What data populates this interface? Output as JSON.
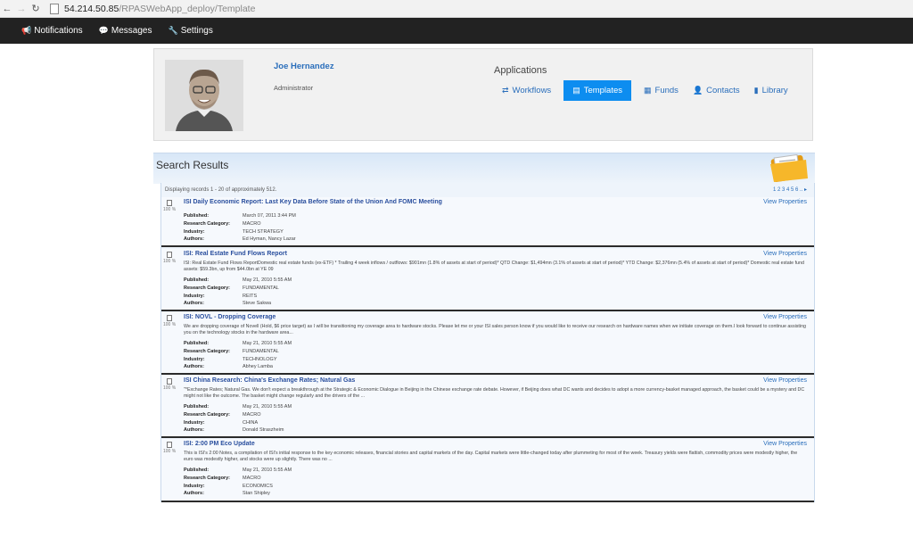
{
  "browser": {
    "url_host": "54.214.50.85",
    "url_path": "/RPASWebApp_deploy/Template"
  },
  "nav": {
    "items": [
      {
        "icon": "bullhorn-icon",
        "glyph": "📢",
        "label": "Notifications"
      },
      {
        "icon": "comment-icon",
        "glyph": "💬",
        "label": "Messages"
      },
      {
        "icon": "wrench-icon",
        "glyph": "🔧",
        "label": "Settings"
      }
    ]
  },
  "profile": {
    "name": "Joe Hernandez",
    "role": "Administrator"
  },
  "applications": {
    "title": "Applications",
    "items": [
      {
        "icon": "swap-icon",
        "glyph": "⇄",
        "label": "Workflows",
        "active": false
      },
      {
        "icon": "document-icon",
        "glyph": "▤",
        "label": "Templates",
        "active": true
      },
      {
        "icon": "bank-icon",
        "glyph": "▦",
        "label": "Funds",
        "active": false
      },
      {
        "icon": "user-icon",
        "glyph": "👤",
        "label": "Contacts",
        "active": false
      },
      {
        "icon": "book-icon",
        "glyph": "▮",
        "label": "Library",
        "active": false
      }
    ]
  },
  "results": {
    "title": "Search Results",
    "records_info": "Displaying records 1 - 20 of approximately 512.",
    "pager": "1 2 3 4 5 6 .. ▸",
    "view_label": "View Properties",
    "labels": {
      "published": "Published:",
      "category": "Research Category:",
      "industry": "Industry:",
      "authors": "Authors:"
    },
    "items": [
      {
        "pct": "100 %",
        "title": "ISI Daily Economic Report: Last Key Data Before State of the Union And FOMC Meeting",
        "snippet": "",
        "published": "March 07, 2011 3:44 PM",
        "category": "MACRO",
        "industry": "TECH STRATEGY",
        "authors": "Ed Hyman, Nancy Lazar"
      },
      {
        "pct": "100 %",
        "title": "ISI: Real Estate Fund Flows Report",
        "snippet": "ISI: Real Estate Fund Flows ReportDomestic real estate funds (ex-ETF) * Trailing 4 week inflows / outflows: $901mn (1.8% of assets at start of period)* QTD Change: $1,494mn (3.1% of assets at start of period)* YTD Change: $2,376mn (5.4% of assets at start of period)* Domestic real estate fund assets: $59.3bn, up from $44.0bn at YE 09",
        "published": "May 21, 2010 5:55 AM",
        "category": "FUNDAMENTAL",
        "industry": "REITS",
        "authors": "Steve Sakwa"
      },
      {
        "pct": "100 %",
        "title": "ISI: NOVL - Dropping Coverage",
        "snippet": "We are dropping coverage of Novell (Hold, $6 price target) as I will be transitioning my coverage area to hardware stocks. Please let me or your ISI sales person know if you would like to receive our research on hardware names when we initiate coverage on them.I look forward to continue assisting you on the technology stocks in the hardware area...",
        "published": "May 21, 2010 5:55 AM",
        "category": "FUNDAMENTAL",
        "industry": "TECHNOLOGY",
        "authors": "Abhey Lamba"
      },
      {
        "pct": "100 %",
        "title": "ISI China Research: China's Exchange Rates; Natural Gas",
        "snippet": "\"*Exchange Rates; Natural Gas. We don't expect a breakthrough at the Strategic & Economic Dialogue in Beijing in the Chinese exchange rate debate. However, if Beijing does what DC wants and decides to adopt a more currency-basket managed approach, the basket could be a mystery and DC might not like the outcome. The basket might change regularly and the drivers of the ...",
        "published": "May 21, 2010 5:55 AM",
        "category": "MACRO",
        "industry": "CHINA",
        "authors": "Donald Straszheim"
      },
      {
        "pct": "100 %",
        "title": "ISI: 2:00 PM Eco Update",
        "snippet": "This is ISI's 2:00 Notes, a compilation of ISI's initial response to the key economic releases, financial stories and capital markets of the day. Capital markets were little-changed today after plummeting for most of the week. Treasury yields were flattish, commodity prices were modestly higher, the euro was modestly higher, and stocks were up slightly. There was no ...",
        "published": "May 21, 2010 5:55 AM",
        "category": "MACRO",
        "industry": "ECONOMICS",
        "authors": "Stan Shipley"
      }
    ]
  }
}
